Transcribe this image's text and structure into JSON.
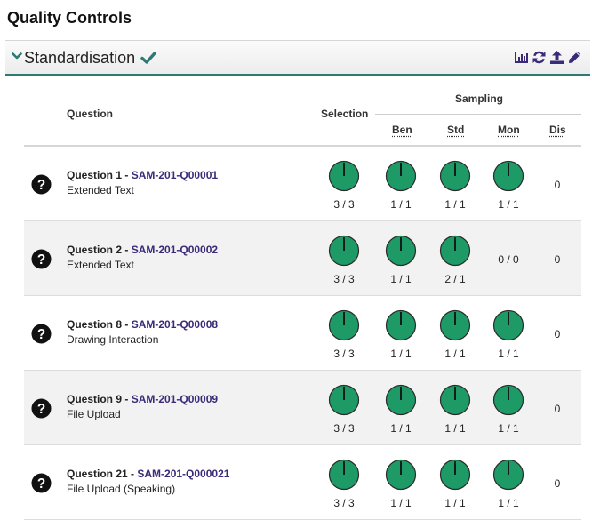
{
  "page_title": "Quality Controls",
  "panel": {
    "title": "Standardisation"
  },
  "icons": {
    "collapse": "chevron-down-icon",
    "status": "check-icon",
    "tools": [
      "bar-chart-icon",
      "refresh-icon",
      "upload-icon",
      "pencil-icon"
    ],
    "help": "question-circle-icon",
    "gauge": "dial-gauge-icon"
  },
  "colors": {
    "accent": "#2c7a72",
    "gauge_fill": "#1e9a66",
    "link": "#3a2a78"
  },
  "table": {
    "headers": {
      "question": "Question",
      "selection": "Selection",
      "sampling": "Sampling"
    },
    "sampling_columns": [
      "Ben",
      "Std",
      "Mon",
      "Dis"
    ],
    "rows": [
      {
        "label": "Question 1",
        "sep": " - ",
        "code": "SAM-201-Q00001",
        "type": "Extended Text",
        "selection": "3 / 3",
        "ben": "1 / 1",
        "std": "1 / 1",
        "mon": "1 / 1",
        "dis": "0",
        "mon_gauge": true
      },
      {
        "label": "Question 2",
        "sep": " - ",
        "code": "SAM-201-Q00002",
        "type": "Extended Text",
        "selection": "3 / 3",
        "ben": "1 / 1",
        "std": "2 / 1",
        "mon": "0 / 0",
        "dis": "0",
        "mon_gauge": false
      },
      {
        "label": "Question 8",
        "sep": " - ",
        "code": "SAM-201-Q00008",
        "type": "Drawing Interaction",
        "selection": "3 / 3",
        "ben": "1 / 1",
        "std": "1 / 1",
        "mon": "1 / 1",
        "dis": "0",
        "mon_gauge": true
      },
      {
        "label": "Question 9",
        "sep": " - ",
        "code": "SAM-201-Q00009",
        "type": "File Upload",
        "selection": "3 / 3",
        "ben": "1 / 1",
        "std": "1 / 1",
        "mon": "1 / 1",
        "dis": "0",
        "mon_gauge": true
      },
      {
        "label": "Question 21",
        "sep": " - ",
        "code": "SAM-201-Q000021",
        "type": "File Upload (Speaking)",
        "selection": "3 / 3",
        "ben": "1 / 1",
        "std": "1 / 1",
        "mon": "1 / 1",
        "dis": "0",
        "mon_gauge": true
      }
    ]
  }
}
